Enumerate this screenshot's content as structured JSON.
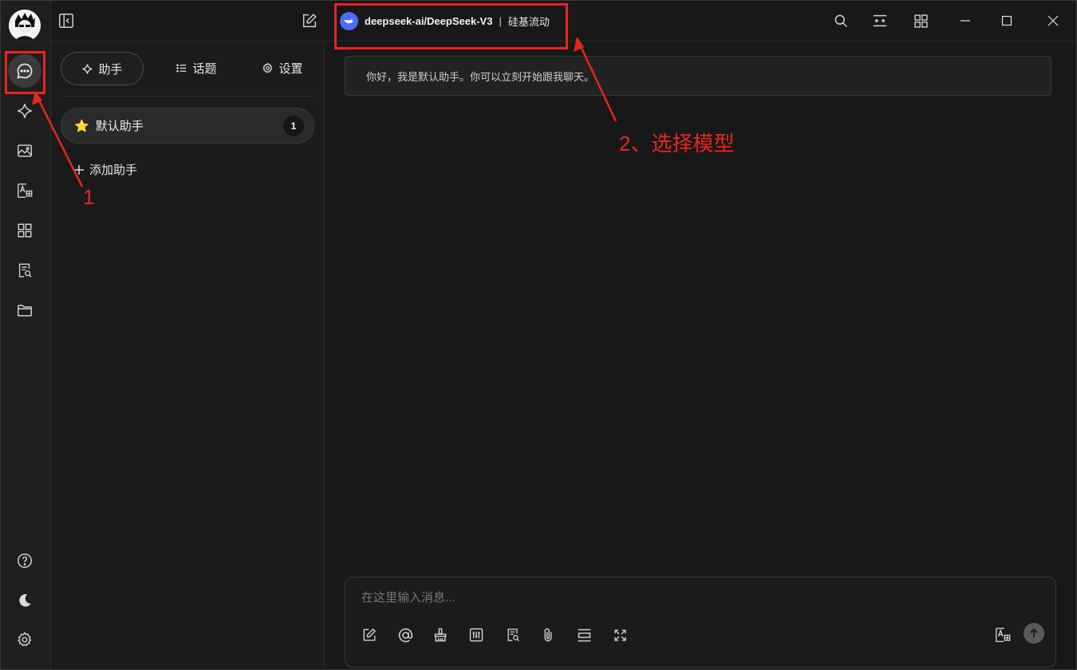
{
  "header": {
    "model_name": "deepseek-ai/DeepSeek-V3",
    "model_separator": "|",
    "model_provider": "硅基流动"
  },
  "sidebar": {
    "tabs": [
      {
        "label": "助手",
        "icon": "sparkle-icon",
        "active": true
      },
      {
        "label": "话题",
        "icon": "list-icon",
        "active": false
      },
      {
        "label": "设置",
        "icon": "gear-icon",
        "active": false
      }
    ],
    "assistants": [
      {
        "emoji": "⭐",
        "name": "默认助手",
        "count": "1"
      }
    ],
    "add_assistant_label": "添加助手"
  },
  "nav_rail": {
    "items": [
      "chat-icon",
      "sparkle-icon",
      "image-icon",
      "translate-icon",
      "apps-icon",
      "file-search-icon",
      "folder-icon"
    ],
    "bottom": [
      "help-icon",
      "moon-icon",
      "gear-icon"
    ]
  },
  "chat": {
    "welcome_message": "你好，我是默认助手。你可以立刻开始跟我聊天。",
    "input_placeholder": "在这里输入消息..."
  },
  "annotations": {
    "step1": "1",
    "step2": "2、选择模型",
    "color": "#e8251f"
  },
  "colors": {
    "background": "#181818",
    "panel": "#1b1b1b",
    "model_logo": "#4d6bfe"
  }
}
